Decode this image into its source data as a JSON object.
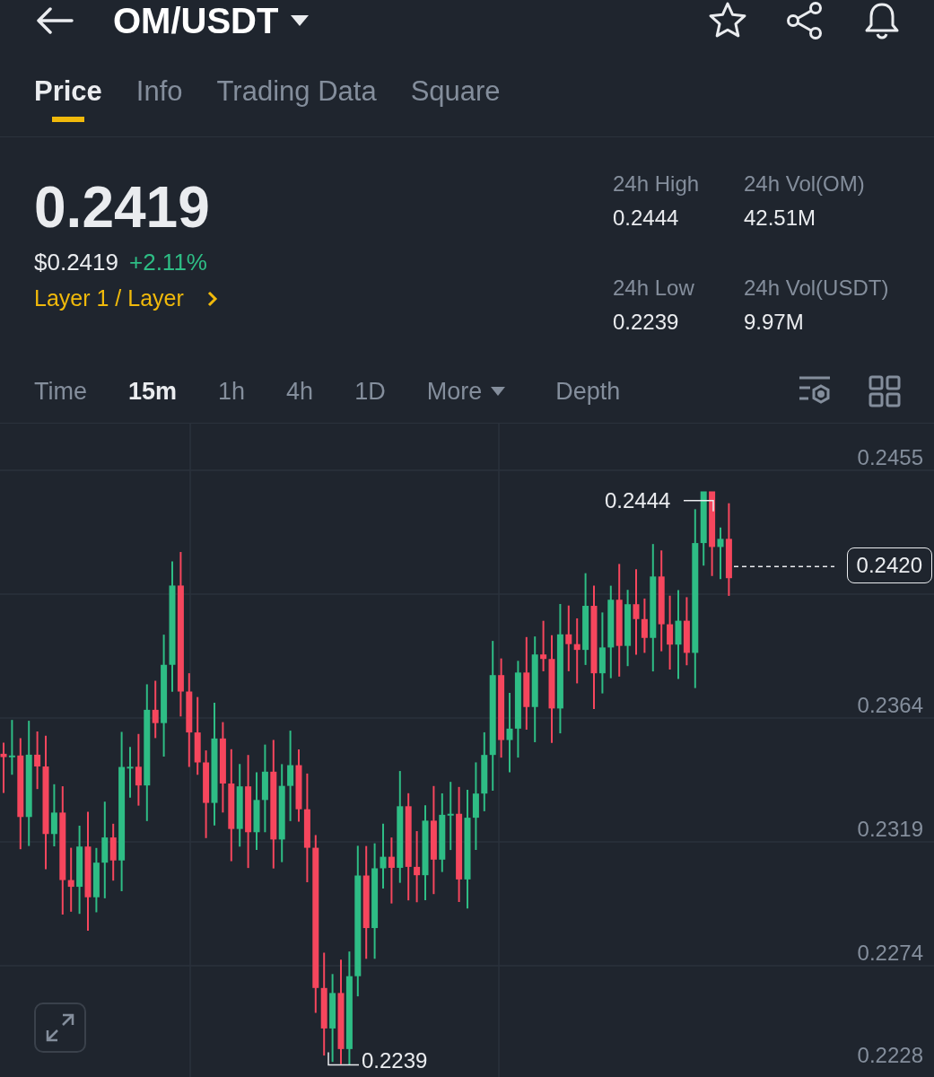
{
  "header": {
    "title": "OM/USDT"
  },
  "tabs": [
    {
      "label": "Price",
      "selected": true
    },
    {
      "label": "Info",
      "selected": false
    },
    {
      "label": "Trading Data",
      "selected": false
    },
    {
      "label": "Square",
      "selected": false
    }
  ],
  "price": {
    "last": "0.2419",
    "usd": "$0.2419",
    "change": "+2.11%",
    "category": "Layer 1 / Layer"
  },
  "stats": [
    {
      "label": "24h High",
      "value": "0.2444"
    },
    {
      "label": "24h Vol(OM)",
      "value": "42.51M"
    },
    {
      "label": "24h Low",
      "value": "0.2239"
    },
    {
      "label": "24h Vol(USDT)",
      "value": "9.97M"
    }
  ],
  "intervals": [
    {
      "label": "Time",
      "selected": false,
      "kind": "option"
    },
    {
      "label": "15m",
      "selected": true,
      "kind": "option"
    },
    {
      "label": "1h",
      "selected": false,
      "kind": "option"
    },
    {
      "label": "4h",
      "selected": false,
      "kind": "option"
    },
    {
      "label": "1D",
      "selected": false,
      "kind": "option"
    },
    {
      "label": "More",
      "selected": false,
      "kind": "menu"
    },
    {
      "label": "Depth",
      "selected": false,
      "kind": "option"
    }
  ],
  "chart": {
    "y_axis": [
      "0.2455",
      "0.2364",
      "0.2319",
      "0.2274",
      "0.2228"
    ],
    "high_label": "0.2444",
    "low_label": "0.2239",
    "last_price": "0.2420"
  }
}
